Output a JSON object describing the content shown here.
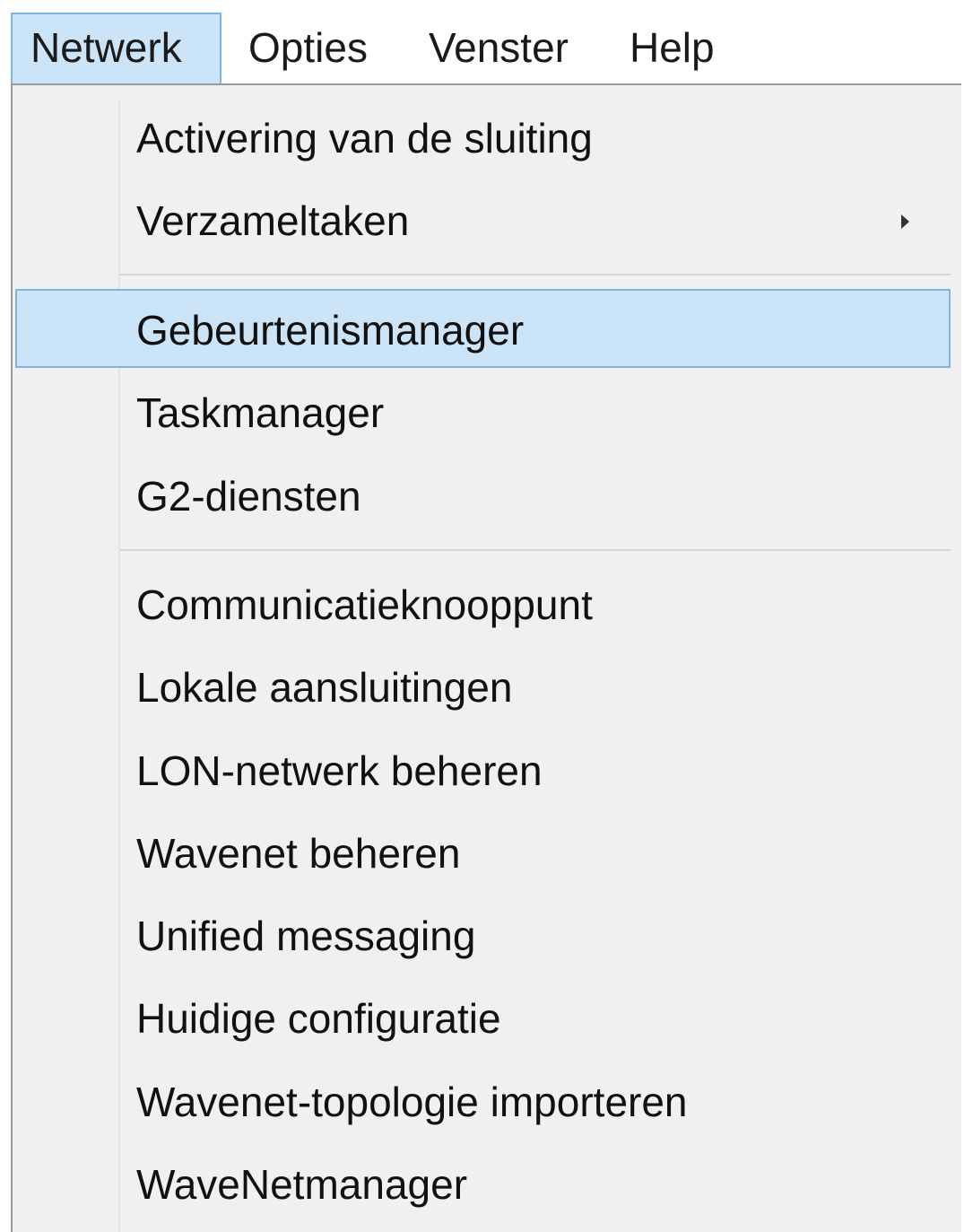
{
  "menubar": {
    "items": [
      {
        "label": "Netwerk"
      },
      {
        "label": "Opties"
      },
      {
        "label": "Venster"
      },
      {
        "label": "Help"
      }
    ]
  },
  "dropdown": {
    "items": [
      {
        "label": "Activering van de sluiting"
      },
      {
        "label": "Verzameltaken",
        "has_submenu": true
      },
      {
        "label": "Gebeurtenismanager",
        "highlighted": true
      },
      {
        "label": "Taskmanager"
      },
      {
        "label": "G2-diensten"
      },
      {
        "label": "Communicatieknooppunt"
      },
      {
        "label": "Lokale aansluitingen"
      },
      {
        "label": "LON-netwerk beheren"
      },
      {
        "label": "Wavenet beheren"
      },
      {
        "label": "Unified messaging"
      },
      {
        "label": "Huidige configuratie"
      },
      {
        "label": "Wavenet-topologie importeren"
      },
      {
        "label": "WaveNetmanager"
      }
    ]
  },
  "colors": {
    "menu_background": "#f0f0f0",
    "highlight_background": "#cce4f7",
    "highlight_border": "#7eb3e0"
  },
  "icons": {
    "submenu_arrow": "submenu-arrow-icon"
  }
}
